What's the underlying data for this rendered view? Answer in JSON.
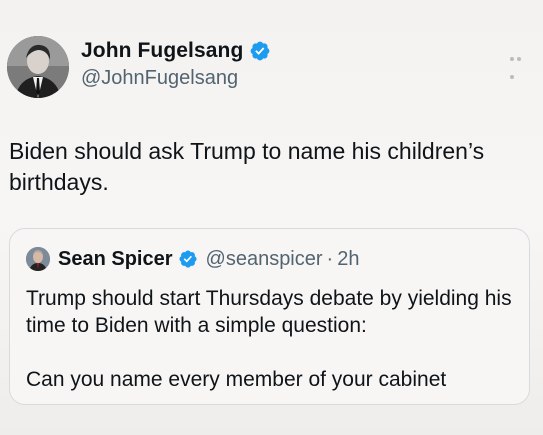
{
  "tweet": {
    "author": {
      "display_name": "John Fugelsang",
      "handle": "@JohnFugelsang",
      "avatar_icon": "profile-photo",
      "verified": true
    },
    "more_icon": "more-options-icon",
    "text": "Biden should ask Trump to name his children’s birthdays."
  },
  "quote": {
    "author": {
      "display_name": "Sean Spicer",
      "handle": "@seanspicer",
      "avatar_icon": "profile-photo",
      "verified": true
    },
    "separator": "·",
    "time": "2h",
    "text": "Trump should start Thursdays debate by yielding his time to Biden with a simple question:\n\nCan you name every member of your cabinet"
  },
  "colors": {
    "verified_blue": "#1d9bf0",
    "secondary_text": "#536471",
    "primary_text": "#0f1419",
    "border": "#d7dbdf"
  }
}
